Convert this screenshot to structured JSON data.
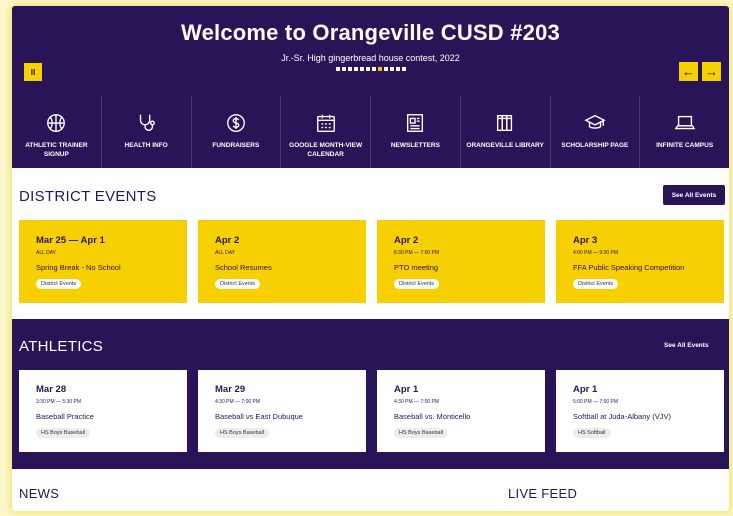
{
  "hero": {
    "title": "Welcome to Orangeville CUSD #203",
    "subtitle": "Jr.-Sr. High gingerbread house contest, 2022",
    "pause_label": "II",
    "prev_label": "←",
    "next_label": "→"
  },
  "quicklinks": [
    {
      "label": "ATHLETIC TRAINER SIGNUP",
      "icon": "basketball-icon"
    },
    {
      "label": "HEALTH INFO",
      "icon": "stethoscope-icon"
    },
    {
      "label": "FUNDRAISERS",
      "icon": "dollar-icon"
    },
    {
      "label": "GOOGLE MONTH-VIEW CALENDAR",
      "icon": "calendar-icon"
    },
    {
      "label": "NEWSLETTERS",
      "icon": "newsletter-icon"
    },
    {
      "label": "ORANGEVILLE LIBRARY",
      "icon": "books-icon"
    },
    {
      "label": "SCHOLARSHIP PAGE",
      "icon": "graduation-cap-icon"
    },
    {
      "label": "INFINITE CAMPUS",
      "icon": "laptop-icon"
    }
  ],
  "district_events": {
    "title": "DISTRICT EVENTS",
    "see_all": "See All Events",
    "items": [
      {
        "date": "Mar 25 — Apr 1",
        "time": "ALL DAY",
        "name": "Spring Break - No School",
        "tag": "District Events"
      },
      {
        "date": "Apr 2",
        "time": "ALL DAY",
        "name": "School Resumes",
        "tag": "District Events"
      },
      {
        "date": "Apr 2",
        "time": "6:30 PM — 7:00 PM",
        "name": "PTO meeting",
        "tag": "District Events"
      },
      {
        "date": "Apr 3",
        "time": "4:00 PM — 9:00 PM",
        "name": "FFA Public Speaking Competition",
        "tag": "District Events"
      }
    ]
  },
  "athletics": {
    "title": "ATHLETICS",
    "see_all": "See All Events",
    "items": [
      {
        "date": "Mar 28",
        "time": "3:30 PM — 5:30 PM",
        "name": "Baseball Practice",
        "tag": "HS Boys Baseball"
      },
      {
        "date": "Mar 29",
        "time": "4:30 PM — 7:00 PM",
        "name": "Baseball vs East Dubuque",
        "tag": "HS Boys Baseball"
      },
      {
        "date": "Apr 1",
        "time": "4:30 PM — 7:00 PM",
        "name": "Baseball vs. Monticello",
        "tag": "HS Boys Baseball"
      },
      {
        "date": "Apr 1",
        "time": "5:00 PM — 7:00 PM",
        "name": "Softball at Juda-Albany (VJV)",
        "tag": "HS Softball"
      }
    ]
  },
  "news": {
    "title": "NEWS"
  },
  "live_feed": {
    "title": "LIVE FEED"
  },
  "colors": {
    "primary": "#2a1458",
    "accent": "#f6d000",
    "background": "#ffffff"
  }
}
